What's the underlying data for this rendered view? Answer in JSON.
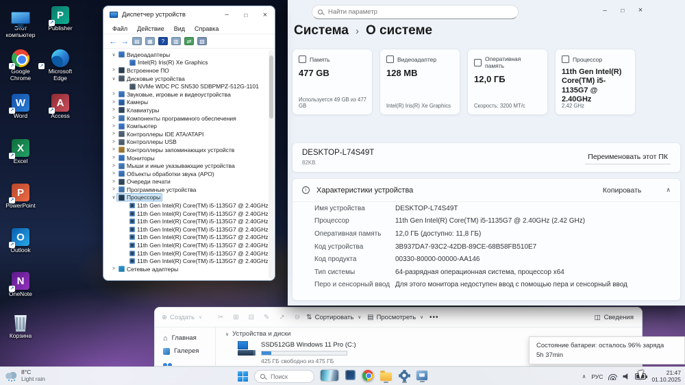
{
  "desktop": {
    "icons": [
      {
        "label": "Этот компьютер",
        "icon": "this-pc-icon"
      },
      {
        "label": "Publisher",
        "icon": "publisher-icon"
      },
      {
        "label": "Google Chrome",
        "icon": "chrome-icon"
      },
      {
        "label": "Microsoft Edge",
        "icon": "edge-icon"
      },
      {
        "label": "Word",
        "icon": "word-icon"
      },
      {
        "label": "Access",
        "icon": "access-icon"
      },
      {
        "label": "Excel",
        "icon": "excel-icon"
      },
      {
        "label": "PowerPoint",
        "icon": "powerpoint-icon"
      },
      {
        "label": "Outlook",
        "icon": "outlook-icon"
      },
      {
        "label": "OneNote",
        "icon": "onenote-icon"
      },
      {
        "label": "Корзина",
        "icon": "recycle-bin-icon"
      }
    ]
  },
  "device_manager": {
    "title": "Диспетчер устройств",
    "menu_items": [
      "Файл",
      "Действие",
      "Вид",
      "Справка"
    ],
    "toolbar_icons": [
      "back-icon",
      "forward-icon",
      "console-icon",
      "properties-icon",
      "help-icon",
      "device-list-icon",
      "scan-icon",
      "legacy-hardware-icon"
    ],
    "tree": [
      {
        "label": "Видеоадаптеры",
        "icon": "display-adapter-icon",
        "state": "expanded",
        "children": [
          {
            "label": "Intel(R) Iris(R) Xe Graphics",
            "icon": "display-adapter-icon"
          }
        ]
      },
      {
        "label": "Встроенное ПО",
        "icon": "firmware-icon",
        "state": "collapsed"
      },
      {
        "label": "Дисковые устройства",
        "icon": "disk-icon",
        "state": "expanded",
        "children": [
          {
            "label": "NVMe WDC PC SN530 SDBPMPZ-512G-1101",
            "icon": "disk-icon"
          }
        ]
      },
      {
        "label": "Звуковые, игровые и видеоустройства",
        "icon": "audio-icon",
        "state": "collapsed"
      },
      {
        "label": "Камеры",
        "icon": "camera-icon",
        "state": "collapsed"
      },
      {
        "label": "Клавиатуры",
        "icon": "keyboard-icon",
        "state": "collapsed"
      },
      {
        "label": "Компоненты программного обеспечения",
        "icon": "software-component-icon",
        "state": "collapsed"
      },
      {
        "label": "Компьютер",
        "icon": "computer-icon",
        "state": "collapsed"
      },
      {
        "label": "Контроллеры IDE ATA/ATAPI",
        "icon": "ide-controller-icon",
        "state": "collapsed"
      },
      {
        "label": "Контроллеры USB",
        "icon": "usb-controller-icon",
        "state": "collapsed"
      },
      {
        "label": "Контроллеры запоминающих устройств",
        "icon": "storage-controller-icon",
        "state": "collapsed"
      },
      {
        "label": "Мониторы",
        "icon": "monitor-icon",
        "state": "collapsed"
      },
      {
        "label": "Мыши и иные указывающие устройства",
        "icon": "mouse-icon",
        "state": "collapsed"
      },
      {
        "label": "Объекты обработки звука (APO)",
        "icon": "audio-processing-icon",
        "state": "collapsed"
      },
      {
        "label": "Очереди печати",
        "icon": "print-queue-icon",
        "state": "collapsed"
      },
      {
        "label": "Программные устройства",
        "icon": "software-device-icon",
        "state": "collapsed"
      },
      {
        "label": "Процессоры",
        "icon": "processor-icon",
        "state": "expanded",
        "selected": true,
        "children": [
          {
            "label": "11th Gen Intel(R) Core(TM) i5-1135G7 @ 2.40GHz",
            "icon": "processor-icon"
          },
          {
            "label": "11th Gen Intel(R) Core(TM) i5-1135G7 @ 2.40GHz",
            "icon": "processor-icon"
          },
          {
            "label": "11th Gen Intel(R) Core(TM) i5-1135G7 @ 2.40GHz",
            "icon": "processor-icon"
          },
          {
            "label": "11th Gen Intel(R) Core(TM) i5-1135G7 @ 2.40GHz",
            "icon": "processor-icon"
          },
          {
            "label": "11th Gen Intel(R) Core(TM) i5-1135G7 @ 2.40GHz",
            "icon": "processor-icon"
          },
          {
            "label": "11th Gen Intel(R) Core(TM) i5-1135G7 @ 2.40GHz",
            "icon": "processor-icon"
          },
          {
            "label": "11th Gen Intel(R) Core(TM) i5-1135G7 @ 2.40GHz",
            "icon": "processor-icon"
          },
          {
            "label": "11th Gen Intel(R) Core(TM) i5-1135G7 @ 2.40GHz",
            "icon": "processor-icon"
          }
        ]
      },
      {
        "label": "Сетевые адаптеры",
        "icon": "network-adapter-icon",
        "state": "collapsed"
      }
    ]
  },
  "settings": {
    "search_placeholder": "Найти параметр",
    "breadcrumb": {
      "parent": "Система",
      "separator": "›",
      "current": "О системе"
    },
    "cards": [
      {
        "icon": "storage-icon",
        "label": "Память",
        "value": "477 GB",
        "detail": "Используется 49 GB из 477 GB"
      },
      {
        "icon": "gpu-icon",
        "label": "Видеоадаптер",
        "value": "128 MB",
        "detail": "Intel(R) Iris(R) Xe Graphics"
      },
      {
        "icon": "ram-icon",
        "label": "Оперативная память",
        "value": "12,0 ГБ",
        "detail": "Скорость: 3200 МТ/с"
      },
      {
        "icon": "cpu-icon",
        "label": "Процессор",
        "value": "11th Gen Intel(R) Core(TM) i5-1135G7 @ 2.40GHz",
        "detail": "2.42 GHz"
      }
    ],
    "device_panel": {
      "name": "DESKTOP-L74S49T",
      "sub": "82KB",
      "rename_button": "Переименовать этот ПК"
    },
    "specs": {
      "title": "Характеристики устройства",
      "copy_button": "Копировать",
      "rows": [
        {
          "label": "Имя устройства",
          "value": "DESKTOP-L74S49T"
        },
        {
          "label": "Процессор",
          "value": "11th Gen Intel(R) Core(TM) i5-1135G7 @ 2.40GHz (2.42 GHz)"
        },
        {
          "label": "Оперативная память",
          "value": "12,0 ГБ (доступно: 11,8 ГБ)"
        },
        {
          "label": "Код устройства",
          "value": "3B937DA7-93C2-42DB-89CE-68B58FB510E7"
        },
        {
          "label": "Код продукта",
          "value": "00330-80000-00000-AA146"
        },
        {
          "label": "Тип системы",
          "value": "64-разрядная операционная система, процессор x64"
        },
        {
          "label": "Перо и сенсорный ввод",
          "value": "Для этого монитора недоступен ввод с помощью пера и сенсорный ввод"
        }
      ]
    }
  },
  "explorer": {
    "toolbar": {
      "new_button": "Создать",
      "action_icons": [
        "cut-icon",
        "copy-icon",
        "paste-icon",
        "rename-icon",
        "share-icon",
        "delete-icon"
      ],
      "sort_button": "Сортировать",
      "view_button": "Просмотреть",
      "more_label": "•••",
      "details_button": "Сведения"
    },
    "sidebar": [
      {
        "label": "Главная",
        "icon": "home-icon"
      },
      {
        "label": "Галерея",
        "icon": "gallery-icon"
      }
    ],
    "group_header": "Устройства и диски",
    "drive": {
      "name": "SSD512GB Windows 11 Pro (C:)",
      "free_text": "425 ГБ свободно из 475 ГБ",
      "used_percent": 11
    }
  },
  "battery_tooltip": {
    "line1": "Состояние батареи: осталось 96% заряда",
    "line2": "5h 37min"
  },
  "taskbar": {
    "weather": {
      "temp": "8°C",
      "condition": "Light rain",
      "icon": "rain-icon"
    },
    "search_label": "Поиск",
    "app_icons": [
      {
        "icon": "taskview-thumbnail-icon",
        "open": false
      },
      {
        "icon": "photos-app-icon",
        "open": false
      },
      {
        "icon": "chrome-icon",
        "open": false
      },
      {
        "icon": "explorer-folder-icon",
        "open": true
      },
      {
        "icon": "settings-gear-icon",
        "open": true
      },
      {
        "icon": "device-manager-icon",
        "open": true
      }
    ],
    "tray": {
      "language": "РУС",
      "icons": [
        "wifi-icon",
        "volume-icon",
        "battery-icon"
      ],
      "time": "21:47",
      "date": "01.10.2025"
    }
  },
  "colors": {
    "accent": "#0067c0",
    "selection": "#cde6f7",
    "taskbar_bg": "#f3f6fa"
  }
}
